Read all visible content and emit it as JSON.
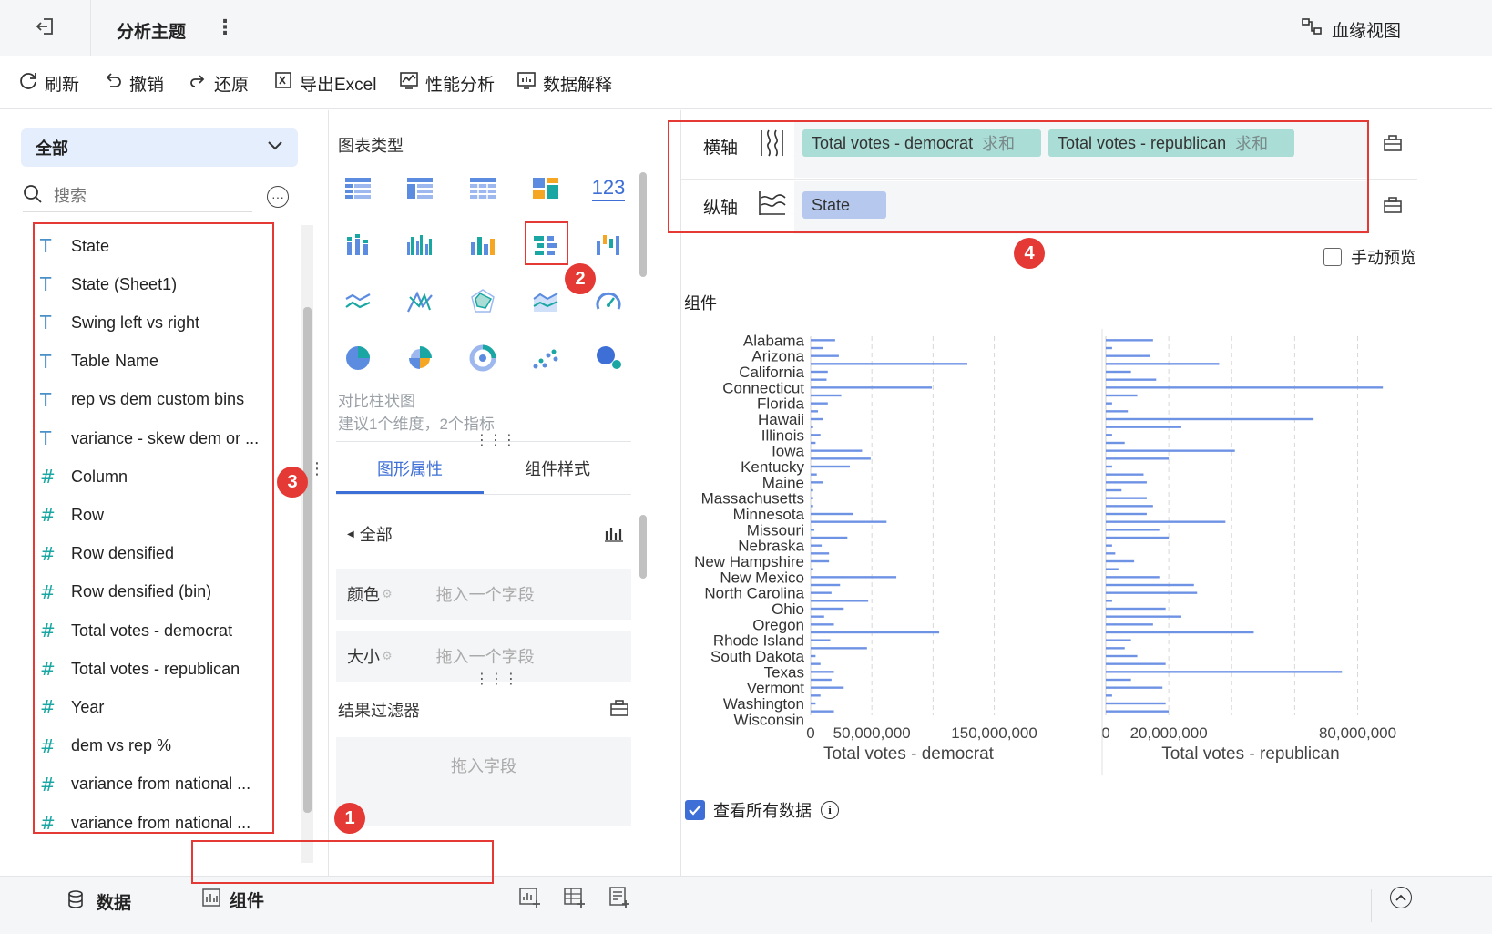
{
  "header": {
    "title": "分析主题",
    "lineage_label": "血缘视图"
  },
  "toolbar": [
    {
      "label": "刷新",
      "icon": "refresh-icon"
    },
    {
      "label": "撤销",
      "icon": "undo-icon"
    },
    {
      "label": "还原",
      "icon": "redo-icon"
    },
    {
      "label": "导出Excel",
      "icon": "excel-icon"
    },
    {
      "label": "性能分析",
      "icon": "performance-icon"
    },
    {
      "label": "数据解释",
      "icon": "data-explain-icon"
    }
  ],
  "left": {
    "dropdown_value": "全部",
    "search_placeholder": "搜索",
    "fields": [
      {
        "type": "T",
        "name": "State"
      },
      {
        "type": "T",
        "name": "State (Sheet1)"
      },
      {
        "type": "T",
        "name": "Swing left vs right"
      },
      {
        "type": "T",
        "name": "Table Name"
      },
      {
        "type": "T",
        "name": "rep vs dem custom bins"
      },
      {
        "type": "T",
        "name": "variance - skew dem or ..."
      },
      {
        "type": "#",
        "name": "Column"
      },
      {
        "type": "#",
        "name": "Row"
      },
      {
        "type": "#",
        "name": "Row densified"
      },
      {
        "type": "#",
        "name": "Row densified (bin)"
      },
      {
        "type": "#",
        "name": "Total votes - democrat"
      },
      {
        "type": "#",
        "name": "Total votes - republican"
      },
      {
        "type": "#",
        "name": "Year"
      },
      {
        "type": "#",
        "name": "dem vs rep %"
      },
      {
        "type": "#",
        "name": "variance from national ..."
      },
      {
        "type": "#",
        "name": "variance from national ..."
      }
    ]
  },
  "middle": {
    "chart_type_title": "图表类型",
    "table_chart_label": "123",
    "chart_desc_name": "对比柱状图",
    "chart_desc_hint": "建议1个维度，2个指标",
    "tab_props": "图形属性",
    "tab_style": "组件样式",
    "all_label": "全部",
    "color_label": "颜色",
    "size_label": "大小",
    "drag_one_field": "拖入一个字段",
    "filter_title": "结果过滤器",
    "drag_field": "拖入字段"
  },
  "right": {
    "x_axis_label": "横轴",
    "y_axis_label": "纵轴",
    "x_pills": [
      {
        "field": "Total votes - democrat",
        "agg": "求和",
        "color": "#a9ddd6"
      },
      {
        "field": "Total votes - republican",
        "agg": "求和",
        "color": "#a9ddd6"
      }
    ],
    "y_pills": [
      {
        "field": "State",
        "agg": "",
        "color": "#b6c8ee"
      }
    ],
    "manual_preview": "手动预览",
    "component_title": "组件",
    "view_all_data": "查看所有数据"
  },
  "bottom": {
    "data_tab": "数据",
    "component_tab": "组件"
  },
  "badges": [
    "1",
    "2",
    "3",
    "4"
  ],
  "chart_data": {
    "type": "bar",
    "orientation": "horizontal",
    "bar_color": "#6f93e4",
    "categories": [
      "Alabama",
      "Arizona",
      "California",
      "Connecticut",
      "Florida",
      "Hawaii",
      "Illinois",
      "Iowa",
      "Kentucky",
      "Maine",
      "Massachusetts",
      "Minnesota",
      "Missouri",
      "Nebraska",
      "New Hampshire",
      "New Mexico",
      "North Carolina",
      "Ohio",
      "Oregon",
      "Rhode Island",
      "South Dakota",
      "Texas",
      "Vermont",
      "Washington",
      "Wisconsin"
    ],
    "all_rows": 48,
    "series": [
      {
        "name": "Total votes - democrat",
        "values": [
          20000000,
          10000000,
          23000000,
          128000000,
          14000000,
          13000000,
          99000000,
          25000000,
          14000000,
          6000000,
          10000000,
          2000000,
          8000000,
          4000000,
          42000000,
          49000000,
          32000000,
          5000000,
          10000000,
          2000000,
          2000000,
          2000000,
          35000000,
          62000000,
          3000000,
          30000000,
          9000000,
          15000000,
          15000000,
          2000000,
          70000000,
          24000000,
          17000000,
          47000000,
          27000000,
          11000000,
          19000000,
          105000000,
          16000000,
          46000000,
          4000000,
          8000000,
          19000000,
          17000000,
          27000000,
          8000000,
          4000000,
          19000000
        ],
        "ticks": [
          "0",
          "50,000,000",
          "150,000,000"
        ],
        "tick_values": [
          0,
          50000000,
          100000000,
          150000000
        ],
        "xlim": [
          0,
          160000000
        ]
      },
      {
        "name": "Total votes - republican",
        "values": [
          15000000,
          2000000,
          14000000,
          36000000,
          8000000,
          16000000,
          88000000,
          10000000,
          2000000,
          7000000,
          66000000,
          24000000,
          2000000,
          6000000,
          41000000,
          20000000,
          2000000,
          12000000,
          13000000,
          5000000,
          13000000,
          15000000,
          13000000,
          38000000,
          17000000,
          20000000,
          2000000,
          3000000,
          9000000,
          4000000,
          17000000,
          28000000,
          29000000,
          2000000,
          19000000,
          24000000,
          15000000,
          47000000,
          8000000,
          6000000,
          10000000,
          19000000,
          75000000,
          8000000,
          18000000,
          2000000,
          19000000,
          20000000
        ],
        "ticks": [
          "0",
          "20,000,000",
          "80,000,000"
        ],
        "tick_values": [
          0,
          20000000,
          40000000,
          60000000,
          80000000
        ],
        "xlim": [
          0,
          92000000
        ]
      }
    ]
  }
}
